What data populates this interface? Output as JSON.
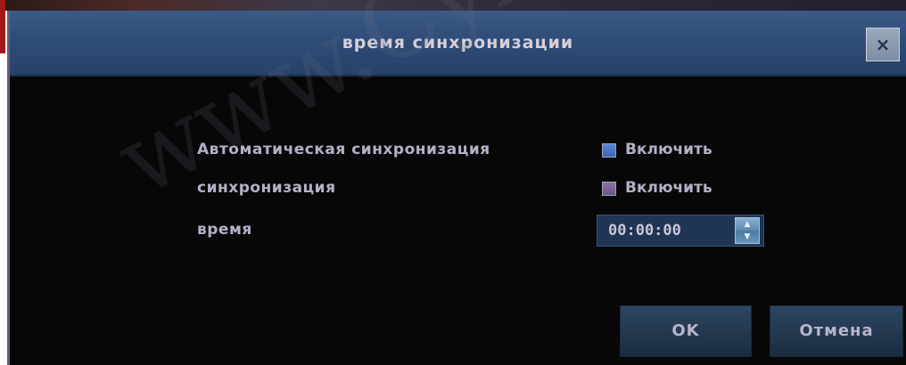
{
  "dialog": {
    "title": "время синхронизации",
    "close_glyph": "×"
  },
  "rows": [
    {
      "label": "Автоматическая синхронизация",
      "checkbox_label": "Включить",
      "checkbox_color": "#4a76c8"
    },
    {
      "label": "синхронизация",
      "checkbox_label": "Включить",
      "checkbox_color": "#7a6296"
    },
    {
      "label": "время",
      "time_value": "00:00:00"
    }
  ],
  "buttons": {
    "ok": "OK",
    "cancel": "Отмена"
  },
  "watermark": "www.Cyron.ru",
  "colors": {
    "titlebar": "#2f4c78",
    "background": "#070708",
    "text": "#b4b0c6"
  },
  "icons": {
    "close": "close-icon",
    "spin_up": "chevron-up-icon",
    "spin_down": "chevron-down-icon"
  }
}
